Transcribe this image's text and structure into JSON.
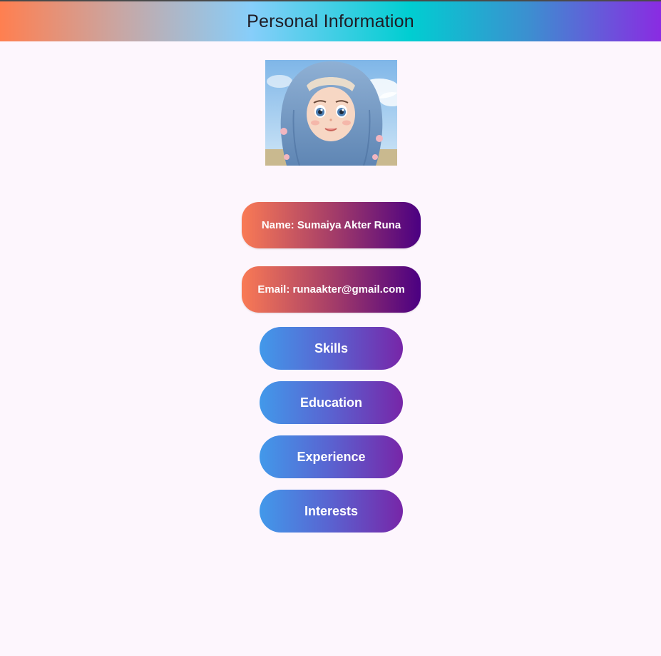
{
  "app_bar": {
    "title": "Personal Information",
    "gradient": [
      "#ff7f50",
      "#87cefa",
      "#00ced1",
      "#8a2be2"
    ]
  },
  "profile_image": {
    "icon": "hijab-girl-avatar"
  },
  "info": {
    "name_label": "Name: Sumaiya Akter Runa",
    "email_label": "Email: runaakter@gmail.com",
    "gradient": [
      "#f97a55",
      "#4b0082"
    ]
  },
  "nav_buttons": [
    {
      "label": "Skills"
    },
    {
      "label": "Education"
    },
    {
      "label": "Experience"
    },
    {
      "label": "Interests"
    }
  ],
  "colors": {
    "background": "#fdf6fd",
    "nav_gradient": [
      "#4299ea",
      "#7726a8"
    ],
    "text_on_button": "#ffffff"
  }
}
